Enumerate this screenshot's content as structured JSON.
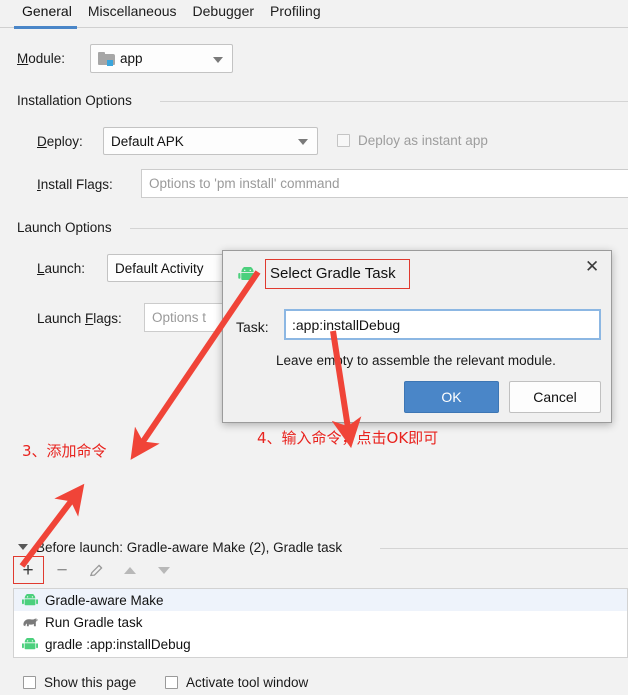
{
  "tabs": [
    {
      "label": "General",
      "active": true
    },
    {
      "label": "Miscellaneous",
      "active": false
    },
    {
      "label": "Debugger",
      "active": false
    },
    {
      "label": "Profiling",
      "active": false
    }
  ],
  "module": {
    "label": "Module:",
    "value": "app",
    "icon": "module-folder-icon"
  },
  "installation": {
    "group_title": "Installation Options",
    "deploy_label": "Deploy:",
    "deploy_value": "Default APK",
    "instant_app_label": "Deploy as instant app",
    "install_flags_label": "Install Flags:",
    "install_flags_placeholder": "Options to 'pm install' command"
  },
  "launch": {
    "group_title": "Launch Options",
    "launch_label": "Launch:",
    "launch_value": "Default Activity",
    "launch_flags_label": "Launch Flags:",
    "launch_flags_placeholder": "Options t"
  },
  "dialog": {
    "title": "Select Gradle Task",
    "close_label": "✕",
    "task_label": "Task:",
    "task_value": ":app:installDebug",
    "hint": "Leave empty to assemble the relevant module.",
    "ok_label": "OK",
    "cancel_label": "Cancel",
    "icon": "android-robot-icon"
  },
  "before_launch": {
    "header": "Before launch: Gradle-aware Make (2), Gradle task",
    "toolbar": [
      {
        "name": "add-button",
        "glyph": "+",
        "enabled": true
      },
      {
        "name": "remove-button",
        "glyph": "−",
        "enabled": false
      },
      {
        "name": "edit-button",
        "glyph": "pencil-icon",
        "enabled": false
      },
      {
        "name": "move-up-button",
        "glyph": "triangle-up-icon",
        "enabled": false
      },
      {
        "name": "move-down-button",
        "glyph": "triangle-down-icon",
        "enabled": false
      }
    ],
    "items": [
      {
        "label": "Gradle-aware Make",
        "icon": "android-robot-icon",
        "selected": true
      },
      {
        "label": "Run Gradle task",
        "icon": "gradle-elephant-icon",
        "selected": false
      },
      {
        "label": "gradle :app:installDebug",
        "icon": "android-robot-icon",
        "selected": false
      }
    ]
  },
  "footer": {
    "show_page_label": "Show this page",
    "activate_tool_window_label": "Activate tool window"
  },
  "annotations": [
    {
      "name": "annotation-step-3",
      "text": "3、添加命令"
    },
    {
      "name": "annotation-step-4",
      "text": "4、输入命令，点击OK即可"
    }
  ],
  "colors": {
    "accent": "#4a86c8",
    "annotation_red": "#e8231e",
    "android_green": "#4cd07d",
    "background": "#f2f2f2"
  }
}
